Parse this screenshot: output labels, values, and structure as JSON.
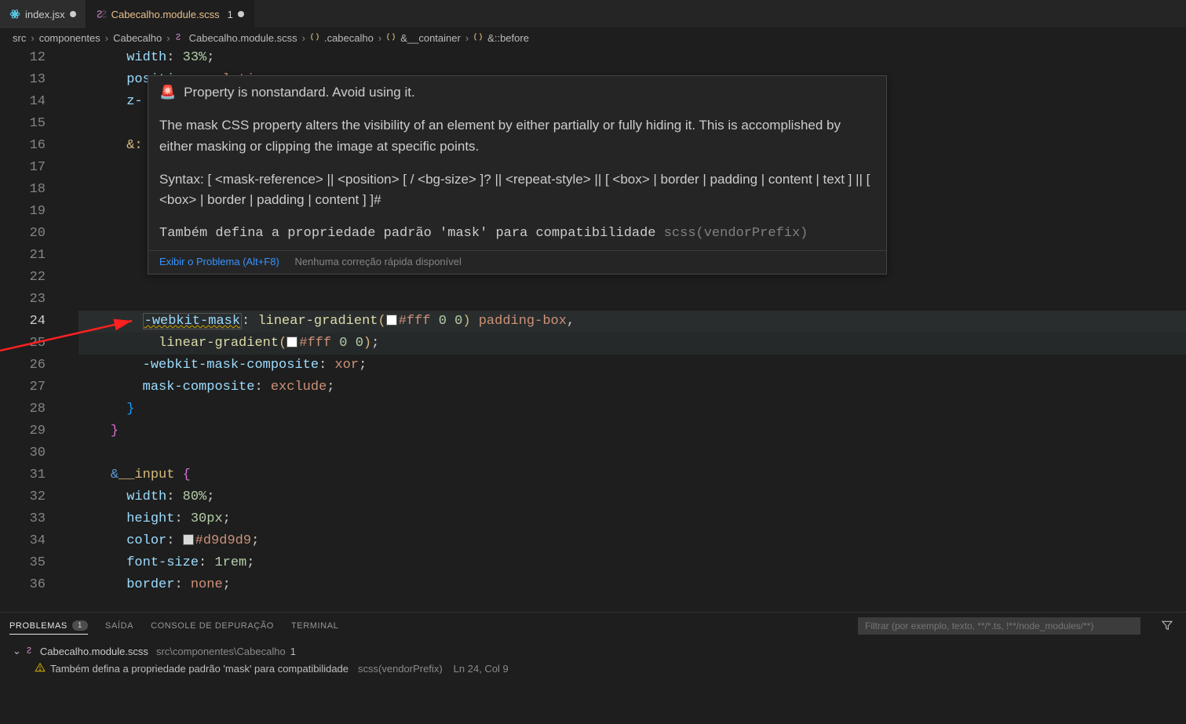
{
  "tabs": [
    {
      "title": "index.jsx",
      "icon": "react",
      "modified": true
    },
    {
      "title": "Cabecalho.module.scss",
      "icon": "scss",
      "badge": "1",
      "modified": true,
      "active": true
    }
  ],
  "breadcrumbs": {
    "parts": [
      "src",
      "componentes",
      "Cabecalho",
      "Cabecalho.module.scss",
      ".cabecalho",
      "&__container",
      "&::before"
    ]
  },
  "lines": {
    "start": 12,
    "end": 36,
    "l12_prop": "width",
    "l12_val": "33%",
    "l13_prop": "position",
    "l13_val": "relative",
    "l14_prop": "z-",
    "l16_sel": "&:",
    "l24_prop": "-webkit-mask",
    "l24_func": "linear-gradient",
    "l24_col": "#fff",
    "l24_z1": "0",
    "l24_z2": "0",
    "l24_box": "padding-box",
    "l25_func": "linear-gradient",
    "l25_col": "#fff",
    "l25_z1": "0",
    "l25_z2": "0",
    "l26_prop": "-webkit-mask-composite",
    "l26_val": "xor",
    "l27_prop": "mask-composite",
    "l27_val": "exclude",
    "l31_sel_amp": "&",
    "l31_sel": "__input",
    "l32_prop": "width",
    "l32_val": "80%",
    "l33_prop": "height",
    "l33_val": "30px",
    "l34_prop": "color",
    "l34_val": "#d9d9d9",
    "l35_prop": "font-size",
    "l35_val": "1rem",
    "l36_prop": "border",
    "l36_val": "none"
  },
  "hover": {
    "heading": "Property is nonstandard. Avoid using it.",
    "desc": "The mask CSS property alters the visibility of an element by either partially or fully hiding it. This is accomplished by either masking or clipping the image at specific points.",
    "syntax_label": "Syntax:",
    "syntax": "[ <mask-reference> || <position> [ / <bg-size> ]? || <repeat-style> || [ <box> | border | padding | content | text ] || [ <box> | border | padding | content ] ]#",
    "message": "Também defina a propriedade padrão 'mask' para compatibilidade",
    "source": "scss(vendorPrefix)",
    "view_problem": "Exibir o Problema (Alt+F8)",
    "no_quick_fix": "Nenhuma correção rápida disponível"
  },
  "panel": {
    "tabs": {
      "problems": "PROBLEMAS",
      "problems_count": "1",
      "output": "SAÍDA",
      "debug": "CONSOLE DE DEPURAÇÃO",
      "terminal": "TERMINAL"
    },
    "filter_placeholder": "Filtrar (por exemplo, texto, **/*.ts, !**/node_modules/**)",
    "file": "Cabecalho.module.scss",
    "file_path": "src\\componentes\\Cabecalho",
    "file_count": "1",
    "warning_text": "Também defina a propriedade padrão 'mask' para compatibilidade",
    "warning_src": "scss(vendorPrefix)",
    "warning_loc": "Ln 24, Col 9"
  }
}
